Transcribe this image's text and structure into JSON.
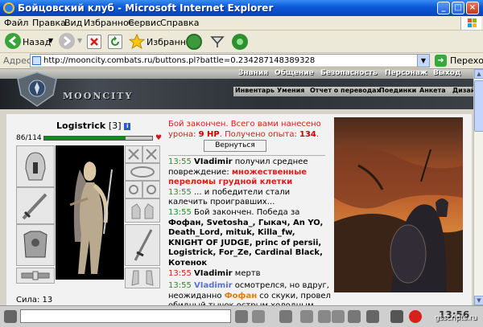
{
  "window": {
    "title": "Бойцовский клуб - Microsoft Internet Explorer",
    "minimize": "_",
    "maximize": "□",
    "close": "×"
  },
  "menu": [
    "Файл",
    "Правка",
    "Вид",
    "Избранное",
    "Сервис",
    "Справка"
  ],
  "toolbar": {
    "back_label": "Назад",
    "favorites_label": "Избранное"
  },
  "address": {
    "label": "Адрес:",
    "url": "http://mooncity.combats.ru/buttons.pl?battle=0.234287148389328",
    "go_label": "Переход"
  },
  "site": {
    "nav_top": [
      "Знания",
      "Общение",
      "Безопасность",
      "Персонаж",
      "Выход"
    ],
    "nav_bottom": [
      "Инвентарь",
      "Умения",
      "Отчет о переводах",
      "Поединки",
      "Анкета",
      "Дизайн"
    ],
    "logo_text": "MOONCITY"
  },
  "character": {
    "name": "Logistrick",
    "level": "[3]",
    "info_icon": "i",
    "hp_text": "86/114",
    "hp_fraction": 0.754,
    "strength_text": "Сила: 13"
  },
  "battle": {
    "result_line": "Бой закончен. Всего вами нанесено урона:",
    "damage": "9 HP",
    "exp_label": ". Получено опыта:",
    "exp_value": "134",
    "exp_end": ".",
    "return_button": "Вернуться"
  },
  "log": [
    {
      "time": "13:55",
      "name": "VIadimir",
      "text": " получил среднее повреждение: ",
      "red": "множественные переломы грудной клетки"
    },
    {
      "time": "13:55",
      "text": " ... и победители стали калечить проигравших..."
    },
    {
      "time": "13:55",
      "text": " Бой закончен. Победа за ",
      "bold": "Фофан, Svetosha_, Гыкач, An YO, Death_Lord, mituk, Killa_fw, KNIGHT OF JUDGE, princ of persii, Logistrick, For_Ze, Cardinal Black, Котенок"
    },
    {
      "time": "13:55",
      "name": "VIadimir",
      "text": " мертв"
    },
    {
      "time": "13:55",
      "blue": "VIadimir",
      "text": " осмотрелся, но вдруг, неожиданно ",
      "orange": "Фофан",
      "text2": " со скуки, провел обидный тычок острым холодным"
    }
  ],
  "icons": {
    "ie": "internet-explorer-icon",
    "back": "back-arrow-icon",
    "forward": "forward-arrow-icon",
    "stop": "stop-icon",
    "refresh": "refresh-icon",
    "favorites": "star-icon",
    "history": "history-icon",
    "go": "go-arrow-icon"
  },
  "taskbar": {
    "clock": "13:56",
    "watermark": "gsscripts.ru"
  }
}
